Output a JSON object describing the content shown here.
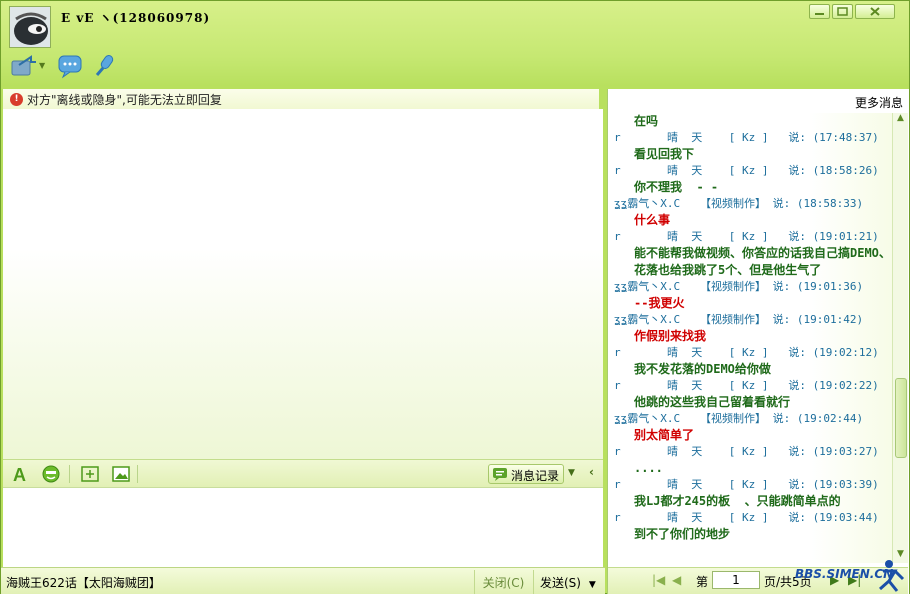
{
  "window": {
    "contact_name": "E vE  ヽ(128060978)"
  },
  "notice": {
    "text": "对方\"离线或隐身\",可能无法立即回复"
  },
  "toolbar": {
    "history_label": "消息记录"
  },
  "bottom": {
    "status_text": "海贼王622话【太阳海贼团】",
    "close_label": "关闭(C)",
    "send_label": "发送(S)"
  },
  "right_panel": {
    "more_label": "更多消息",
    "messages": [
      {
        "head": "",
        "body": "在吗",
        "red": false
      },
      {
        "head": "r       晴  天    [ Kz ]   说: (17:48:37)",
        "body": "看见回我下",
        "red": false
      },
      {
        "head": "r       晴  天    [ Kz ]   说: (18:58:26)",
        "body": "你不理我  - -",
        "red": false
      },
      {
        "head": "ʓʓ霸气丶X.C   【视频制作】 说: (18:58:33)",
        "body": "什么事",
        "red": true
      },
      {
        "head": "r       晴  天    [ Kz ]   说: (19:01:21)",
        "body": "能不能帮我做视频、你答应的话我自己搞DEMO、花落也给我跳了5个、但是他生气了",
        "red": false
      },
      {
        "head": "ʓʓ霸气丶X.C   【视频制作】 说: (19:01:36)",
        "body": "--我更火",
        "red": true
      },
      {
        "head": "ʓʓ霸气丶X.C   【视频制作】 说: (19:01:42)",
        "body": "作假别来找我",
        "red": true
      },
      {
        "head": "r       晴  天    [ Kz ]   说: (19:02:12)",
        "body": "我不发花落的DEMO给你做",
        "red": false
      },
      {
        "head": "r       晴  天    [ Kz ]   说: (19:02:22)",
        "body": "他跳的这些我自己留着看就行",
        "red": false
      },
      {
        "head": "ʓʓ霸气丶X.C   【视频制作】 说: (19:02:44)",
        "body": "别太简单了",
        "red": true
      },
      {
        "head": "r       晴  天    [ Kz ]   说: (19:03:27)",
        "body": "....",
        "red": false
      },
      {
        "head": "r       晴  天    [ Kz ]   说: (19:03:39)",
        "body": "我LJ都才245的板  、只能跳简单点的",
        "red": false
      },
      {
        "head": "r       晴  天    [ Kz ]   说: (19:03:44)",
        "body": "到不了你们的地步",
        "red": false
      }
    ],
    "pager": {
      "page_prefix": "第",
      "page_value": "1",
      "page_suffix": "页/共5页"
    }
  },
  "watermark": "BBS.SIMEN.CN",
  "colors": {
    "frame_green": "#b8e05e",
    "msg_green": "#1f6a1a",
    "msg_red": "#d00000",
    "head_blue": "#1d6e9c"
  }
}
